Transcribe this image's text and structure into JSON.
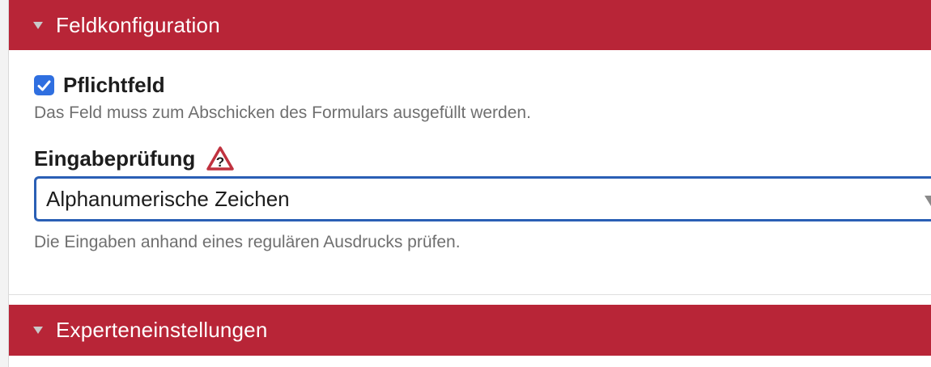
{
  "sections": {
    "field_config": {
      "title": "Feldkonfiguration"
    },
    "expert": {
      "title": "Experteneinstellungen"
    }
  },
  "required": {
    "label": "Pflichtfeld",
    "checked": true,
    "help": "Das Feld muss zum Abschicken des Formulars ausgefüllt werden."
  },
  "validation": {
    "label": "Eingabeprüfung",
    "selected": "Alphanumerische Zeichen",
    "help": "Die Eingaben anhand eines regulären Ausdrucks prüfen."
  },
  "colors": {
    "header_bg": "#b82537",
    "checkbox_accent": "#2f6fe0",
    "select_border": "#2a5fb5"
  },
  "icons": {
    "collapse": "triangle-down-icon",
    "checkmark": "checkmark-icon",
    "warning": "warning-question-icon",
    "select_caret": "caret-down-icon"
  }
}
